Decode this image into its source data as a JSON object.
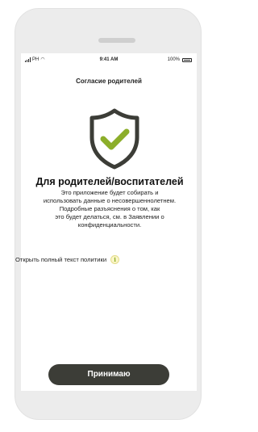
{
  "status_bar": {
    "carrier": "PH",
    "time": "9:41 AM",
    "battery": "100%"
  },
  "screen": {
    "title": "Согласие родителей",
    "icon": "shield-check-icon",
    "heading": "Для родителей/воспитателей",
    "body_lines": [
      "Это приложение будет собирать и",
      "использовать данные о несовершеннолетнем.",
      "Подробные разъяснения о том, как",
      "это будет делаться, см. в Заявлении о",
      "конфиденциальности."
    ],
    "policy_link": "Открыть полный текст политики",
    "policy_icon": "info-icon",
    "accept_button": "Принимаю"
  },
  "colors": {
    "shield_outline": "#3c3d37",
    "check_mark": "#8cae2a",
    "button_bg": "#3c3d37",
    "phone_frame": "#ececec"
  }
}
